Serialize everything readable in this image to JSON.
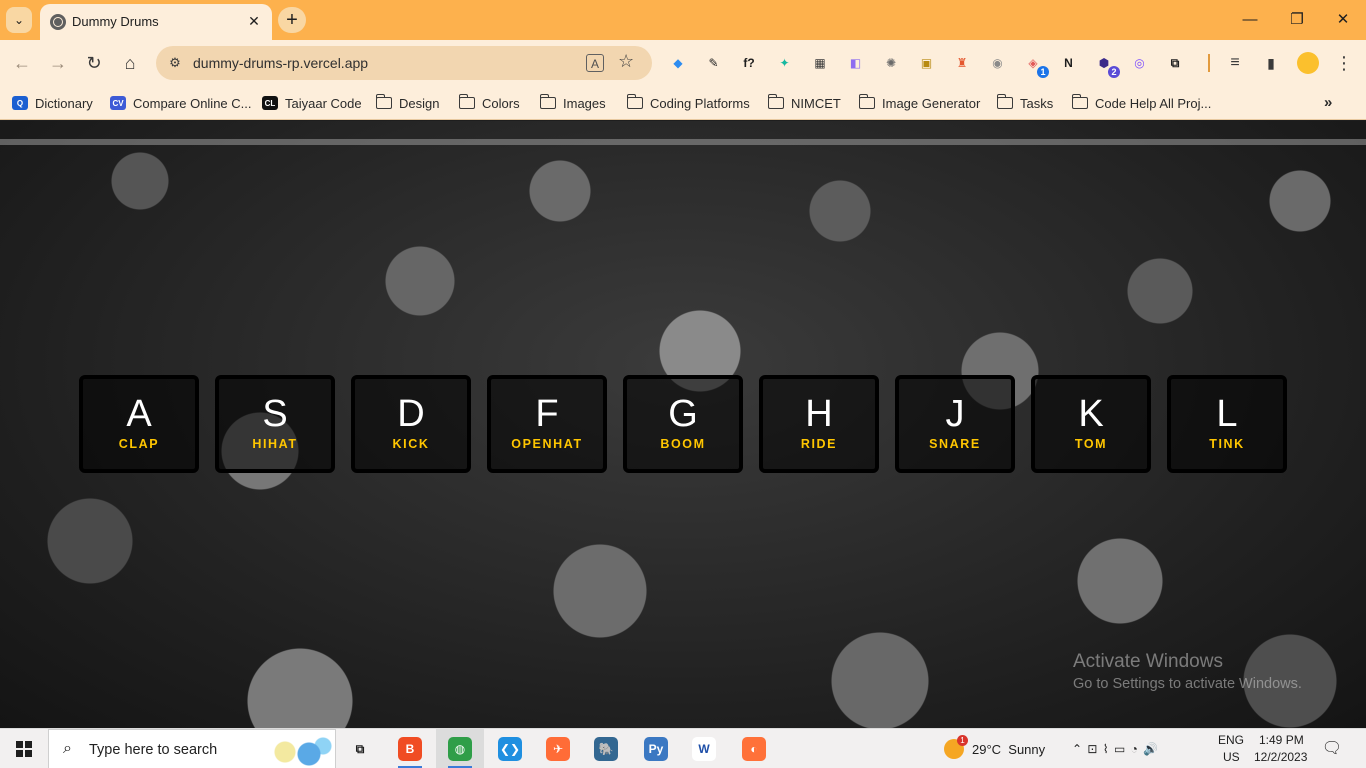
{
  "browser": {
    "tab_title": "Dummy Drums",
    "tab_close": "✕",
    "new_tab": "+",
    "tab_search_glyph": "⌄",
    "window_controls": {
      "minimize": "—",
      "restore": "❐",
      "close": "✕"
    },
    "nav": {
      "back": "←",
      "forward": "→",
      "reload": "↻",
      "home": "⌂"
    },
    "url": "dummy-drums-rp.vercel.app",
    "site_info_glyph": "⚙",
    "translate_glyph": "A",
    "star_glyph": "☆",
    "extensions": [
      {
        "name": "ext-1",
        "glyph": "◆",
        "color": "#2d8cf0"
      },
      {
        "name": "ext-eyedropper",
        "glyph": "✎",
        "color": "#1e1e1e"
      },
      {
        "name": "ext-f",
        "glyph": "f?",
        "color": "#1e1e1e"
      },
      {
        "name": "ext-teal",
        "glyph": "✦",
        "color": "#16b8a0"
      },
      {
        "name": "ext-grid",
        "glyph": "▦",
        "color": "#3a3a3a"
      },
      {
        "name": "ext-gradient",
        "glyph": "◧",
        "color": "#8e6cf0"
      },
      {
        "name": "ext-gear",
        "glyph": "✺",
        "color": "#6a6a6a"
      },
      {
        "name": "ext-yellow",
        "glyph": "▣",
        "color": "#b88a10"
      },
      {
        "name": "ext-orange",
        "glyph": "♜",
        "color": "#e4572e"
      },
      {
        "name": "ext-camera",
        "glyph": "◉",
        "color": "#8a8a8a"
      },
      {
        "name": "ext-badge-1",
        "glyph": "◈",
        "color": "#e25a5a",
        "badge": "1",
        "badge_color": "#1b73e8"
      },
      {
        "name": "ext-notion",
        "glyph": "N",
        "color": "#1e1e1e"
      },
      {
        "name": "ext-hex",
        "glyph": "⬢",
        "color": "#3b2a8a",
        "badge": "2",
        "badge_color": "#5a4bd6"
      },
      {
        "name": "ext-purple",
        "glyph": "◎",
        "color": "#7c4dff"
      },
      {
        "name": "ext-puzzle",
        "glyph": "⧉",
        "color": "#1e1e1e"
      }
    ],
    "toolbar_end": {
      "media": "≡",
      "sidepanel": "▮",
      "menu": "⋮"
    },
    "bookmarks": [
      {
        "label": "Dictionary",
        "icon": "dictionary-icon",
        "color": "#1b5fd1",
        "glyph": "Q"
      },
      {
        "label": "Compare Online C...",
        "icon": "cv-icon",
        "color": "#3d5ad6",
        "glyph": "CV"
      },
      {
        "label": "Taiyaar Code",
        "icon": "cl-icon",
        "color": "#111111",
        "glyph": "CL"
      },
      {
        "label": "Design",
        "icon": "folder-icon"
      },
      {
        "label": "Colors",
        "icon": "folder-icon"
      },
      {
        "label": "Images",
        "icon": "folder-icon"
      },
      {
        "label": "Coding Platforms",
        "icon": "folder-icon"
      },
      {
        "label": "NIMCET",
        "icon": "folder-icon"
      },
      {
        "label": "Image Generator",
        "icon": "folder-icon"
      },
      {
        "label": "Tasks",
        "icon": "folder-icon"
      },
      {
        "label": "Code Help All Proj...",
        "icon": "folder-icon"
      }
    ],
    "bookmarks_more": "»"
  },
  "drum_keys": [
    {
      "key": "A",
      "sound": "CLAP"
    },
    {
      "key": "S",
      "sound": "HIHAT"
    },
    {
      "key": "D",
      "sound": "KICK"
    },
    {
      "key": "F",
      "sound": "OPENHAT"
    },
    {
      "key": "G",
      "sound": "BOOM"
    },
    {
      "key": "H",
      "sound": "RIDE"
    },
    {
      "key": "J",
      "sound": "SNARE"
    },
    {
      "key": "K",
      "sound": "TOM"
    },
    {
      "key": "L",
      "sound": "TINK"
    }
  ],
  "watermark": {
    "title": "Activate Windows",
    "subtitle": "Go to Settings to activate Windows."
  },
  "taskbar": {
    "search_placeholder": "Type here to search",
    "search_glyph": "⌕",
    "apps": [
      {
        "name": "task-view",
        "glyph": "⧉",
        "color": "#1e1e1e",
        "bg": "transparent"
      },
      {
        "name": "brave",
        "glyph": "B",
        "color": "#ffffff",
        "bg": "#f04c23",
        "running": true
      },
      {
        "name": "chrome",
        "glyph": "◍",
        "color": "#ffffff",
        "bg": "#2f9e48",
        "running": true,
        "active": true
      },
      {
        "name": "vscode",
        "glyph": "❮❯",
        "color": "#ffffff",
        "bg": "#1f8fe0"
      },
      {
        "name": "postman",
        "glyph": "✈",
        "color": "#ffffff",
        "bg": "#ff6c37"
      },
      {
        "name": "pgadmin",
        "glyph": "🐘",
        "color": "#ffffff",
        "bg": "#336791"
      },
      {
        "name": "python",
        "glyph": "Py",
        "color": "#ffffff",
        "bg": "#3b78c2"
      },
      {
        "name": "wps",
        "glyph": "W",
        "color": "#1e4fa8",
        "bg": "#ffffff"
      },
      {
        "name": "firefox",
        "glyph": "◐",
        "color": "#ffffff",
        "bg": "#ff7139"
      }
    ],
    "weather": {
      "temp": "29°C",
      "condition": "Sunny"
    },
    "tray_glyphs": "⌃  ⊡  ⌇  ▭  ◔  🔊",
    "lang_line1": "ENG",
    "lang_line2": "US",
    "time": "1:49 PM",
    "date": "12/2/2023",
    "notification_glyph": "🗨"
  }
}
